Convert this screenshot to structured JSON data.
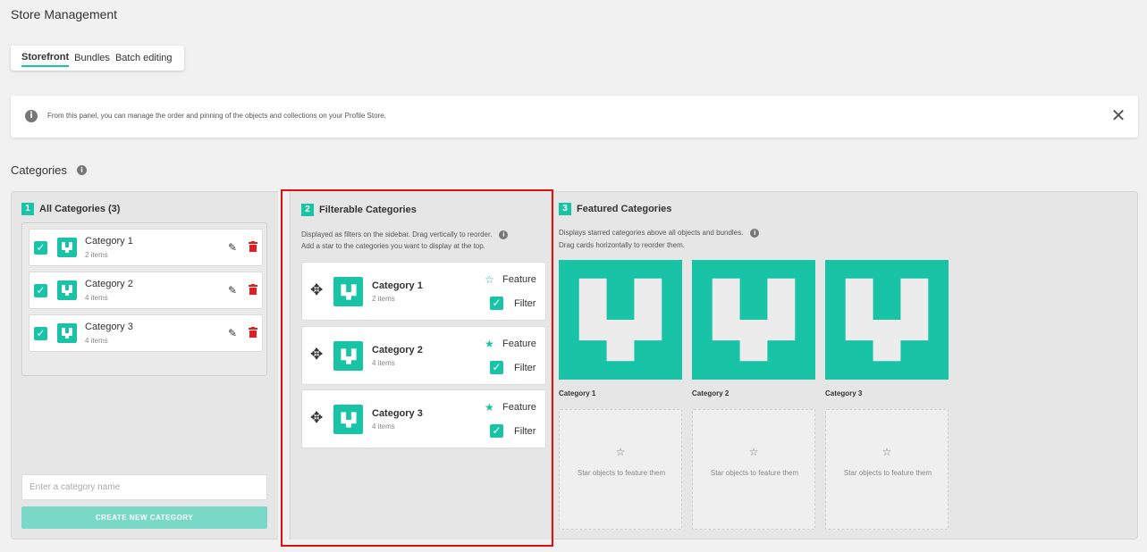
{
  "page": {
    "title": "Store Management"
  },
  "tabs": [
    {
      "label": "Storefront",
      "active": true
    },
    {
      "label": "Bundles",
      "active": false
    },
    {
      "label": "Batch editing",
      "active": false
    }
  ],
  "banner": {
    "text": "From this panel, you can manage the order and pinning of the objects and collections on your Profile Store.",
    "info_icon": "i",
    "close_icon": "✕"
  },
  "categories_section": {
    "title": "Categories",
    "info_icon": "i"
  },
  "all_categories": {
    "number": "1",
    "title": "All Categories (3)",
    "items": [
      {
        "name": "Category 1",
        "count": "2 items"
      },
      {
        "name": "Category 2",
        "count": "4 items"
      },
      {
        "name": "Category 3",
        "count": "4 items"
      }
    ],
    "input_placeholder": "Enter a category name",
    "create_button": "CREATE NEW CATEGORY"
  },
  "filterable": {
    "number": "2",
    "title": "Filterable Categories",
    "desc_line1": "Displayed as filters on the sidebar. Drag vertically to reorder.",
    "desc_line2": "Add a star to the categories you want to display at the top.",
    "info_icon": "i",
    "feature_label": "Feature",
    "filter_label": "Filter",
    "items": [
      {
        "name": "Category 1",
        "count": "2 items",
        "featured": false,
        "star": "☆"
      },
      {
        "name": "Category 2",
        "count": "4 items",
        "featured": true,
        "star": "★"
      },
      {
        "name": "Category 3",
        "count": "4 items",
        "featured": true,
        "star": "★"
      }
    ]
  },
  "featured": {
    "number": "3",
    "title": "Featured Categories",
    "desc_line1": "Displays starred categories above all objects and bundles.",
    "desc_line2": "Drag cards horizontally to reorder them.",
    "info_icon": "i",
    "items": [
      {
        "name": "Category 1"
      },
      {
        "name": "Category 2"
      },
      {
        "name": "Category 3"
      }
    ],
    "placeholder_star": "☆",
    "placeholder_text": "Star objects to feature them"
  },
  "colors": {
    "accent": "#19c3a5",
    "delete": "#e02020",
    "highlight_box": "#e01010"
  },
  "icons": {
    "checkbox": "check-icon",
    "edit": "pencil-icon",
    "delete": "trash-icon",
    "drag": "move-icon",
    "logo": "brand-logo-icon"
  }
}
